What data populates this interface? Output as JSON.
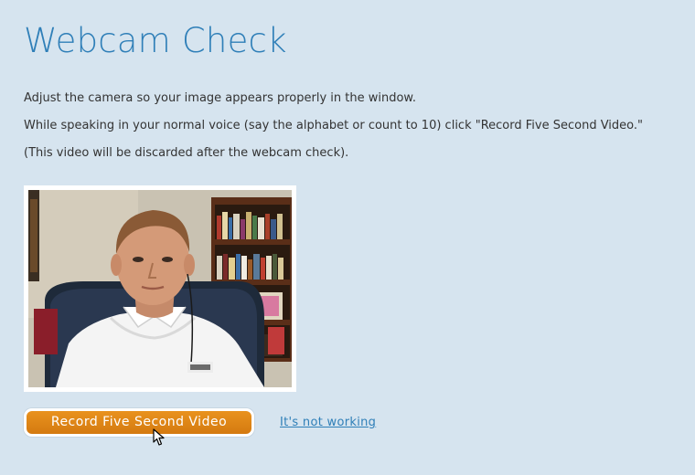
{
  "page": {
    "title": "Webcam Check"
  },
  "instructions": {
    "line1": "Adjust the camera so your image appears properly in the window.",
    "line2": "While speaking in your normal voice (say the alphabet or count to 10) click \"Record Five Second Video.\"",
    "line3": "(This video will be discarded after the webcam check)."
  },
  "video": {
    "icon": "webcam-preview"
  },
  "actions": {
    "record_label": "Record Five Second Video",
    "not_working_label": "It's not working"
  },
  "colors": {
    "background": "#d6e4ef",
    "title": "#2f7fb8",
    "button": "#e08a18",
    "link": "#2f7fb8"
  }
}
